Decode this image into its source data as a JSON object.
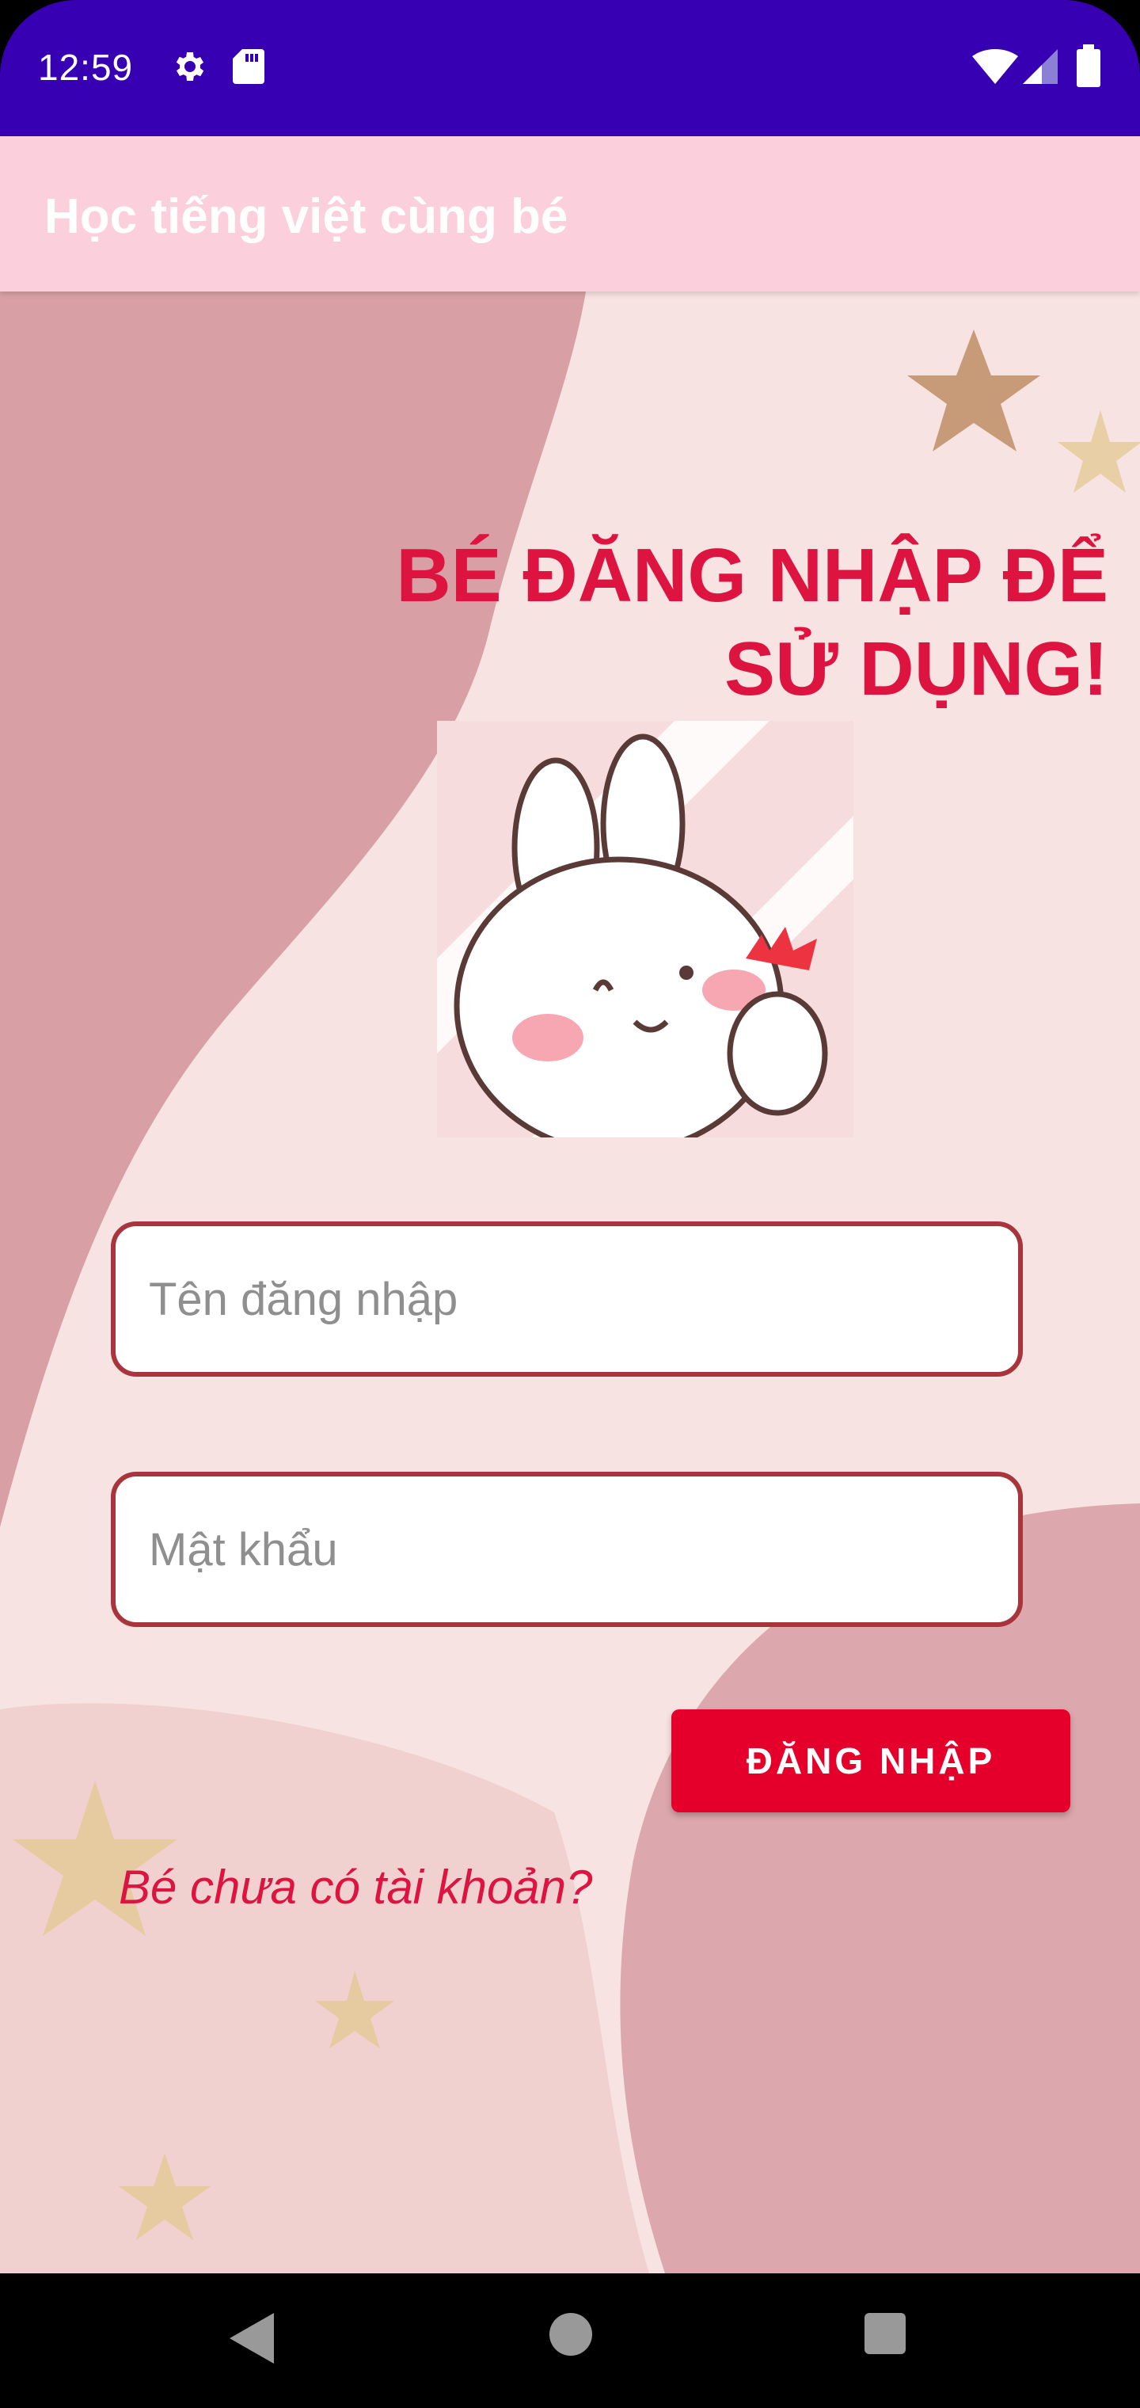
{
  "status_bar": {
    "time": "12:59",
    "icons": [
      "settings-icon",
      "sd-card-icon",
      "wifi-icon",
      "signal-icon",
      "battery-icon"
    ]
  },
  "app_bar": {
    "title": "Học tiếng việt cùng bé",
    "background": "#fccfdc"
  },
  "login": {
    "heading_line1": "BÉ ĐĂNG NHẬP ĐỂ",
    "heading_line2": "SỬ DỤNG!",
    "username_placeholder": "Tên đăng nhập",
    "password_placeholder": "Mật khẩu",
    "login_button": "ĐĂNG NHẬP",
    "register_link": "Bé chưa có tài khoản?"
  },
  "nav_bar": {
    "buttons": [
      "back-icon",
      "home-icon",
      "recents-icon"
    ]
  },
  "colors": {
    "status_bar": "#3700b3",
    "accent_red": "#dd1440",
    "button_red": "#e4002b",
    "input_border": "#a8343c",
    "background": "#f7e3e1"
  }
}
